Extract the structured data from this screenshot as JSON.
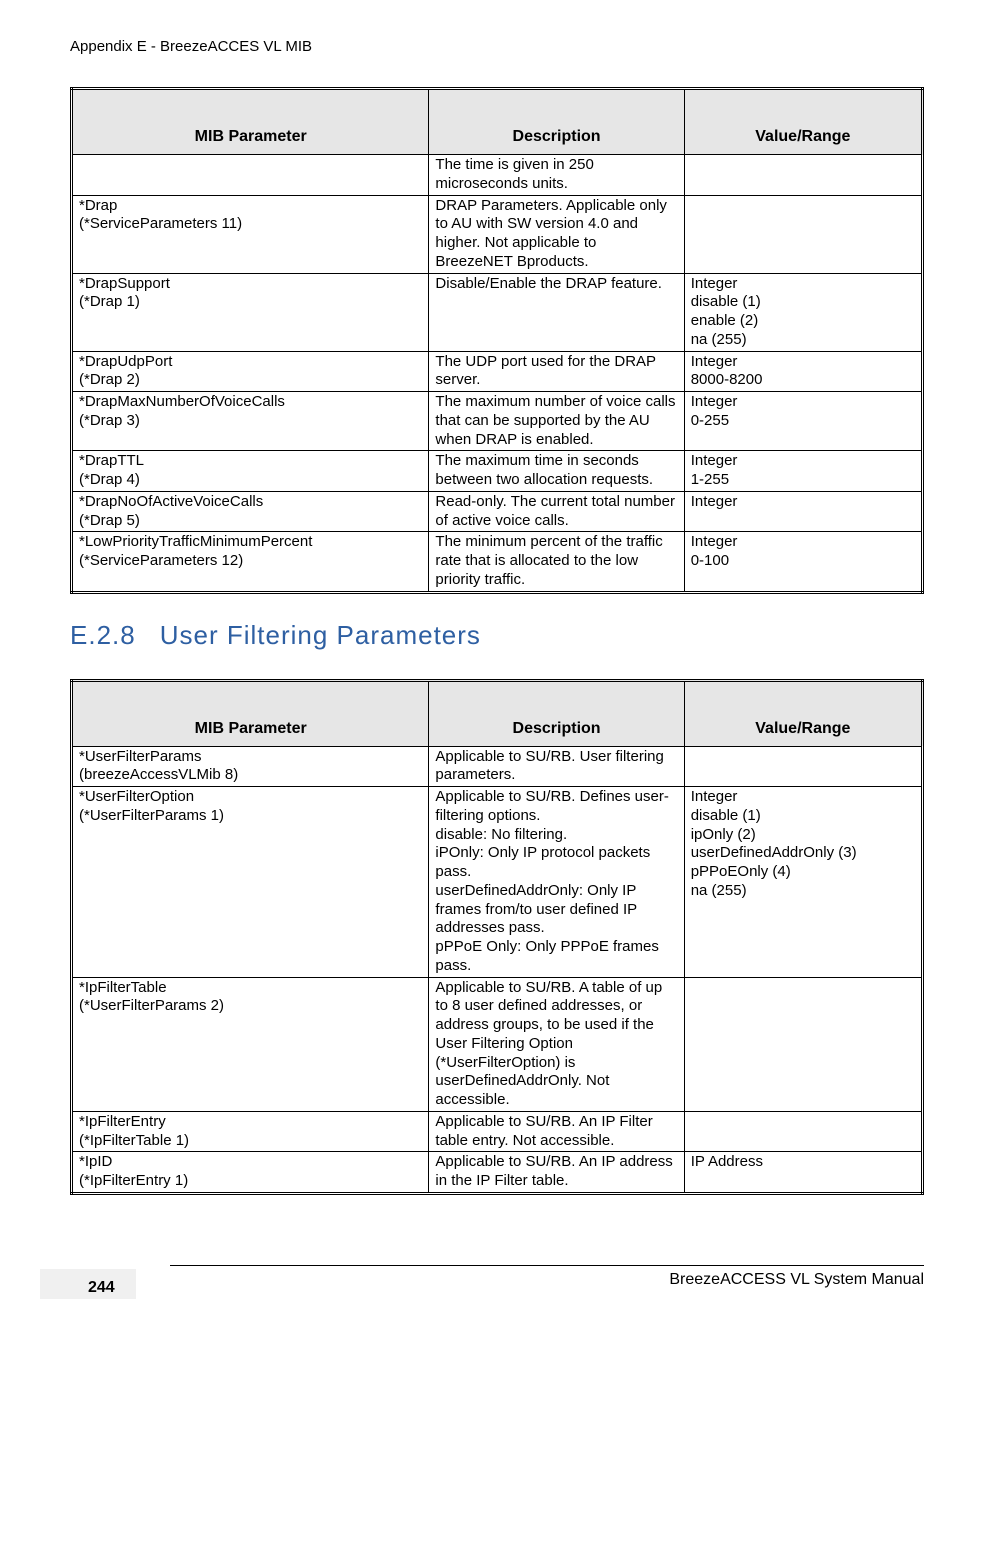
{
  "header": {
    "text": "Appendix E - BreezeACCES VL MIB"
  },
  "table1": {
    "headers": {
      "c1": "MIB Parameter",
      "c2": "Description",
      "c3": "Value/Range"
    },
    "rows": [
      {
        "p": "",
        "d": "The time is given in 250 microseconds units.",
        "v": ""
      },
      {
        "p": "*Drap\n(*ServiceParameters 11)",
        "d": "DRAP Parameters. Applicable only to AU with SW version 4.0 and higher. Not applicable to BreezeNET Bproducts.",
        "v": ""
      },
      {
        "p": "*DrapSupport\n(*Drap 1)",
        "d": "Disable/Enable the DRAP feature.",
        "v": "Integer\ndisable (1)\nenable (2)\nna (255)"
      },
      {
        "p": "*DrapUdpPort\n(*Drap 2)",
        "d": "The UDP port used for the DRAP server.",
        "v": "Integer\n8000-8200"
      },
      {
        "p": "*DrapMaxNumberOfVoiceCalls\n(*Drap 3)",
        "d": "The maximum number of voice calls that can be supported by the AU when DRAP is enabled.",
        "v": "Integer\n0-255"
      },
      {
        "p": "*DrapTTL\n(*Drap 4)",
        "d": "The maximum time in seconds between two allocation requests.",
        "v": "Integer\n1-255"
      },
      {
        "p": "*DrapNoOfActiveVoiceCalls\n(*Drap 5)",
        "d": "Read-only. The current total number of active voice calls.",
        "v": "Integer"
      },
      {
        "p": "*LowPriorityTrafficMinimumPercent\n(*ServiceParameters 12)",
        "d": "The minimum percent of the traffic rate that is allocated to the low priority traffic.",
        "v": "Integer\n0-100"
      }
    ]
  },
  "section": {
    "num": "E.2.8",
    "title": "User Filtering Parameters"
  },
  "table2": {
    "headers": {
      "c1": "MIB Parameter",
      "c2": "Description",
      "c3": "Value/Range"
    },
    "rows": [
      {
        "p": "*UserFilterParams\n(breezeAccessVLMib 8)",
        "d": "Applicable to SU/RB. User filtering parameters.",
        "v": ""
      },
      {
        "p": "*UserFilterOption\n(*UserFilterParams 1)",
        "d": "Applicable to SU/RB. Defines user-filtering options.\ndisable: No filtering.\niPOnly: Only IP protocol packets pass.\nuserDefinedAddrOnly: Only IP frames from/to user defined IP addresses pass.\npPPoE Only: Only PPPoE frames pass.",
        "v": "Integer\ndisable (1)\nipOnly (2)\nuserDefinedAddrOnly (3)\npPPoEOnly (4)\nna (255)"
      },
      {
        "p": "*IpFilterTable\n(*UserFilterParams 2)",
        "d": "Applicable to SU/RB. A table of up to 8 user defined addresses, or address groups, to be used if the User Filtering Option (*UserFilterOption) is userDefinedAddrOnly. Not accessible.",
        "v": ""
      },
      {
        "p": "*IpFilterEntry\n(*IpFilterTable 1)",
        "d": "Applicable to SU/RB. An IP Filter table entry. Not accessible.",
        "v": ""
      },
      {
        "p": "*IpID\n(*IpFilterEntry 1)",
        "d": "Applicable to SU/RB. An IP address in the IP Filter table.",
        "v": "IP Address"
      }
    ]
  },
  "footer": {
    "title": "BreezeACCESS VL System Manual",
    "page": "244"
  }
}
